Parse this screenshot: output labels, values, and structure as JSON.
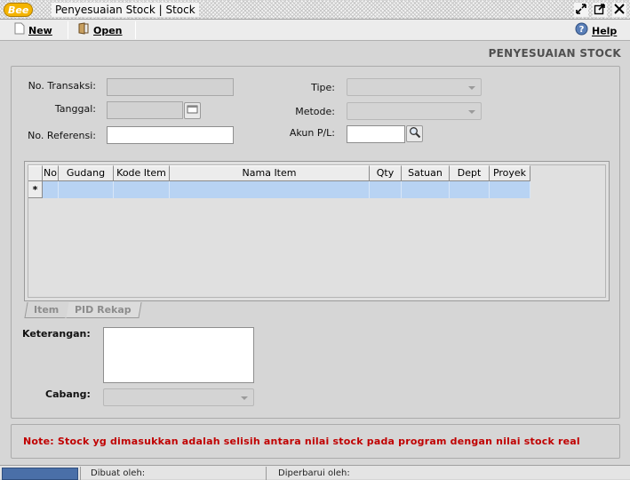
{
  "window": {
    "logo_text": "Bee",
    "title": "Penyesuaian Stock | Stock",
    "controls": [
      "restore-icon",
      "maximize-icon",
      "close-icon"
    ]
  },
  "toolbar": {
    "new_label": "New",
    "open_label": "Open",
    "help_label": "Help"
  },
  "page_heading": "PENYESUAIAN STOCK",
  "form": {
    "no_transaksi_label": "No. Transaksi:",
    "no_transaksi_value": "",
    "tanggal_label": "Tanggal:",
    "tanggal_value": "",
    "no_referensi_label": "No. Referensi:",
    "no_referensi_value": "",
    "tipe_label": "Tipe:",
    "tipe_value": "",
    "metode_label": "Metode:",
    "metode_value": "",
    "akun_label": "Akun P/L:",
    "akun_value": ""
  },
  "grid": {
    "columns": [
      "No",
      "Gudang",
      "Kode Item",
      "Nama Item",
      "Qty",
      "Satuan",
      "Dept",
      "Proyek"
    ],
    "new_row_marker": "*"
  },
  "tabs": [
    "Item",
    "PID Rekap"
  ],
  "lower": {
    "keterangan_label": "Keterangan:",
    "keterangan_value": "",
    "cabang_label": "Cabang:",
    "cabang_value": ""
  },
  "note": "Note:  Stock yg dimasukkan adalah selisih antara nilai stock pada program dengan nilai stock real",
  "status": {
    "dibuat_label": "Dibuat oleh:",
    "diperbarui_label": "Diperbarui oleh:"
  }
}
